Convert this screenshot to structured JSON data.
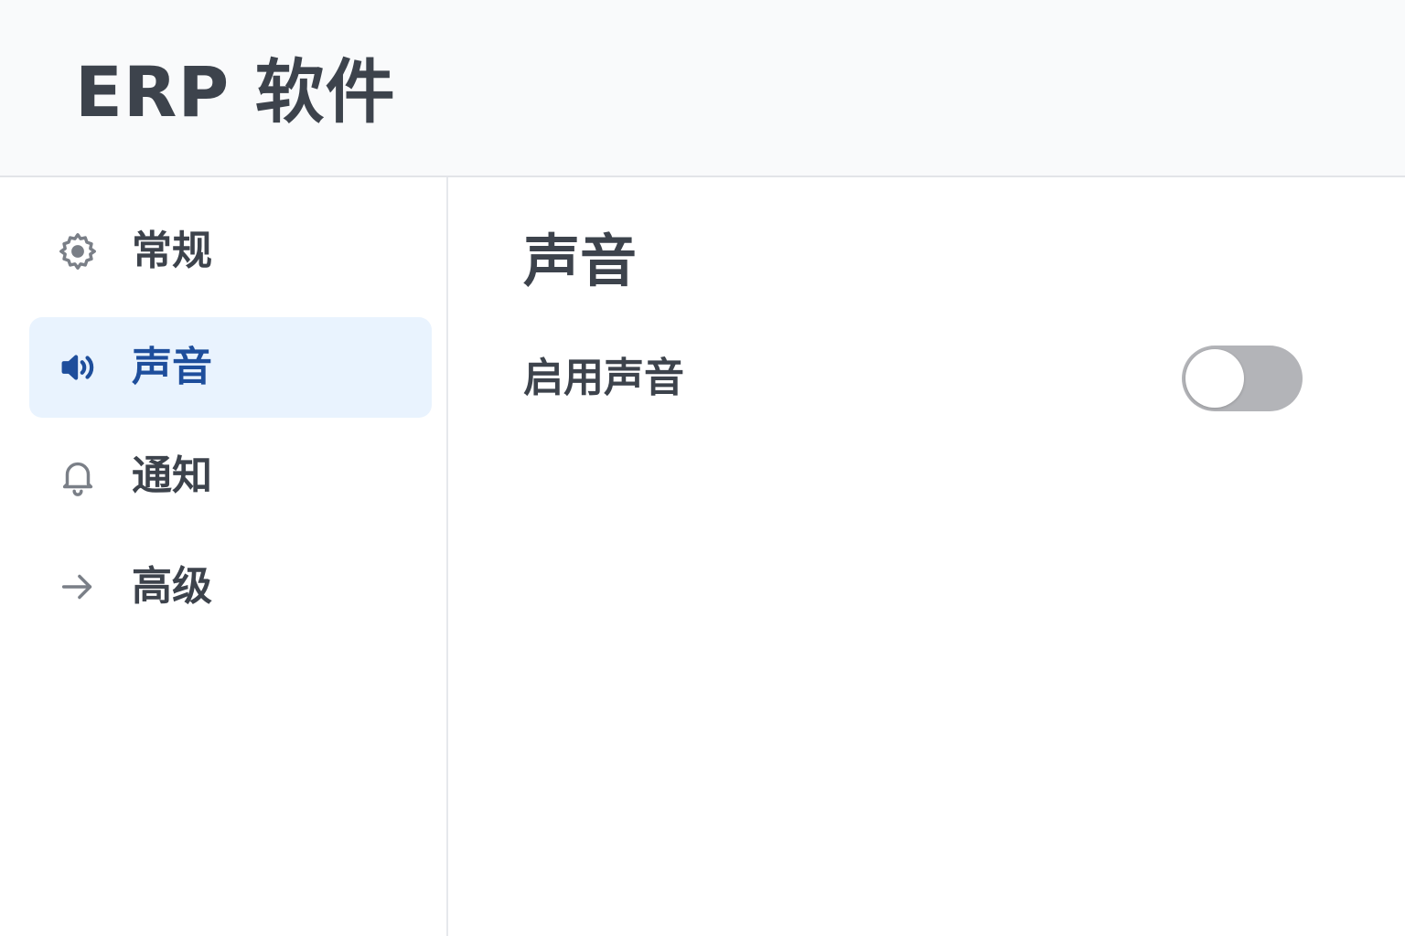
{
  "header": {
    "title": "ERP 软件"
  },
  "sidebar": {
    "items": [
      {
        "label": "常规",
        "icon": "gear-icon",
        "active": false
      },
      {
        "label": "声音",
        "icon": "speaker-icon",
        "active": true
      },
      {
        "label": "通知",
        "icon": "bell-icon",
        "active": false
      },
      {
        "label": "高级",
        "icon": "arrow-right-icon",
        "active": false
      }
    ]
  },
  "main": {
    "section_title": "声音",
    "settings": [
      {
        "label": "启用声音",
        "enabled": false
      }
    ]
  },
  "colors": {
    "header_bg": "#f9fafb",
    "active_bg": "#e9f3fe",
    "active_text": "#1e4e9c",
    "text": "#3d434c",
    "icon_gray": "#7a7f87",
    "toggle_off": "#b3b4b8"
  }
}
